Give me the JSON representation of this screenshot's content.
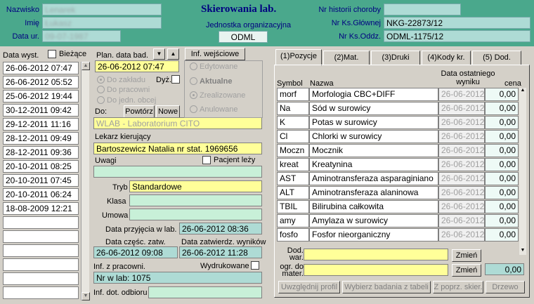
{
  "header": {
    "title": "Skierowania lab.",
    "jednostka_label": "Jednostka organizacyjna",
    "jednostka_value": "ODML",
    "nazwisko_label": "Nazwisko",
    "nazwisko_value": "Lenarek",
    "imie_label": "Imię",
    "imie_value": "Łukasz",
    "data_ur_label": "Data ur.",
    "data_ur_value": "09-07-1987",
    "nr_historii_label": "Nr historii choroby",
    "nr_historii_value": "",
    "nr_ks_glownej_label": "Nr Ks.Głównej",
    "nr_ks_glownej_value": "NKG-22873/12",
    "nr_ks_oddz_label": "Nr Ks.Oddz.",
    "nr_ks_oddz_value": "ODML-1175/12"
  },
  "left": {
    "data_wyst_label": "Data wyst.",
    "biezace_label": "Bieżące",
    "dates": [
      "26-06-2012 07:47",
      "26-06-2012 05:52",
      "25-06-2012 19:44",
      "30-12-2011 09:42",
      "29-12-2011 11:16",
      "28-12-2011 09:49",
      "28-12-2011 09:36",
      "20-10-2011 08:25",
      "20-10-2011 07:45",
      "20-10-2011 06:24",
      "18-08-2009 12:21",
      "",
      "",
      "",
      "",
      "",
      ""
    ]
  },
  "middle": {
    "plan_data_label": "Plan. data bad.",
    "plan_data_value": "26-06-2012 07:47",
    "radio_zakladu": "Do zakładu",
    "radio_pracowni": "Do pracowni",
    "radio_jedn": "Do jedn. obcej",
    "dyz_label": "Dyż.",
    "do_label": "Do:",
    "powtorz_label": "Powtórz",
    "nowe_label": "Nowe",
    "do_value": "WLAB - Laboratorium CITO",
    "lekarz_label": "Lekarz kierujący",
    "lekarz_value": "Bartoszewicz Natalia nr stat. 1969656",
    "uwagi_label": "Uwagi",
    "pacjent_lezy_label": "Pacjent leży",
    "uwagi_value": "",
    "tryb_label": "Tryb",
    "tryb_value": "Standardowe",
    "klasa_label": "Klasa",
    "klasa_value": "",
    "umowa_label": "Umowa",
    "umowa_value": "",
    "data_przyjecia_label": "Data przyjęcia w lab.",
    "data_przyjecia_value": "26-06-2012 08:36",
    "data_czesc_label": "Data częśc. zatw.",
    "data_czesc_value": "26-06-2012 09:08",
    "data_zatw_label": "Data zatwierdz. wyników",
    "data_zatw_value": "26-06-2012 11:28",
    "inf_z_pracowni_label": "Inf. z pracowni.",
    "wydrukowane_label": "Wydrukowane",
    "inf_z_pracowni_value": "Nr w lab: 1075",
    "inf_dot_odbioru_label": "Inf. dot. odbioru",
    "inf_dot_odbioru_value": ""
  },
  "status": {
    "inf_wejsciowe_label": "Inf. wejściowe",
    "edytowane": "Edytowane",
    "aktualne": "Aktualne",
    "zrealizowane": "Zrealizowane",
    "anulowane": "Anulowane"
  },
  "tabs": [
    "(1)Pozycje",
    "(2)Mat.",
    "(3)Druki",
    "(4)Kody kr.",
    "(5) Dod."
  ],
  "table": {
    "col_symbol": "Symbol",
    "col_nazwa": "Nazwa",
    "col_data": "Data ostatniego wyniku",
    "col_cena": "cena",
    "rows": [
      {
        "symbol": "morf",
        "nazwa": "Morfologia CBC+DIFF",
        "data": "26-06-2012",
        "cena": "0,00"
      },
      {
        "symbol": "Na",
        "nazwa": "Sód w surowicy",
        "data": "26-06-2012",
        "cena": "0,00"
      },
      {
        "symbol": "K",
        "nazwa": "Potas w surowicy",
        "data": "26-06-2012",
        "cena": "0,00"
      },
      {
        "symbol": "Cl",
        "nazwa": "Chlorki w surowicy",
        "data": "26-06-2012",
        "cena": "0,00"
      },
      {
        "symbol": "Moczn",
        "nazwa": "Mocznik",
        "data": "26-06-2012",
        "cena": "0,00"
      },
      {
        "symbol": "kreat",
        "nazwa": "Kreatynina",
        "data": "26-06-2012",
        "cena": "0,00"
      },
      {
        "symbol": "AST",
        "nazwa": "Aminotransferaza asparaginiano",
        "data": "26-06-2012",
        "cena": "0,00"
      },
      {
        "symbol": "ALT",
        "nazwa": "Aminotransferaza alaninowa",
        "data": "26-06-2012",
        "cena": "0,00"
      },
      {
        "symbol": "TBIL",
        "nazwa": "Bilirubina całkowita",
        "data": "26-06-2012",
        "cena": "0,00"
      },
      {
        "symbol": "amy",
        "nazwa": "Amylaza w surowicy",
        "data": "26-06-2012",
        "cena": "0,00"
      },
      {
        "symbol": "fosfo",
        "nazwa": "Fosfor nieorganiczny",
        "data": "26-06-2012",
        "cena": "0,00"
      }
    ]
  },
  "bottom": {
    "dod_war_label": "Dod. war.",
    "ogr_do_mater_label": "ogr. do mater.",
    "zmien_label": "Zmień",
    "total_value": "0,00",
    "uwzglednij_label": "Uwzględnij profil",
    "wybierz_label": "Wybierz badania z tabeli",
    "z_poprz_label": "Z poprz. skier.",
    "drzewo_label": "Drzewo"
  }
}
